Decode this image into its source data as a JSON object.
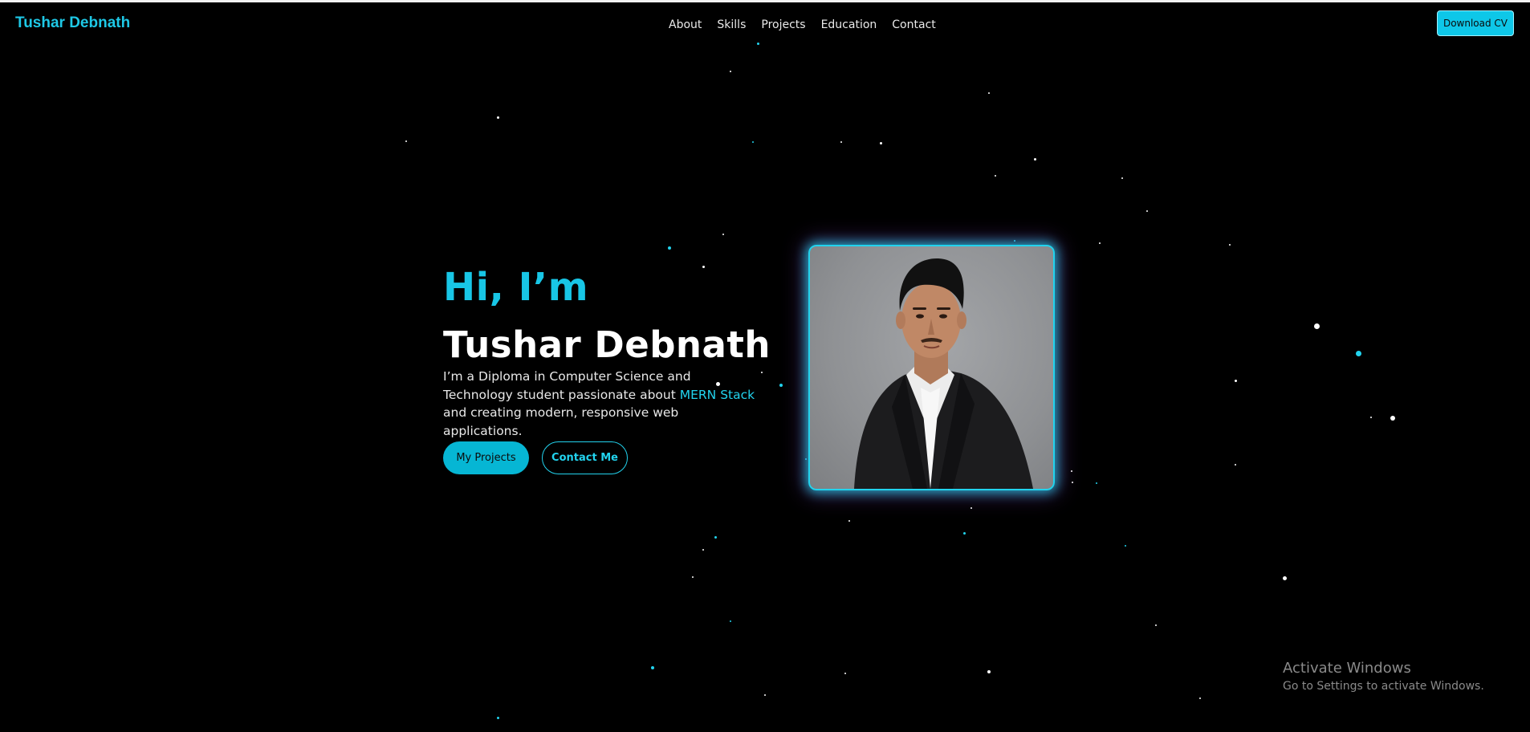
{
  "nav": {
    "brand": "Tushar Debnath",
    "links": [
      "About",
      "Skills",
      "Projects",
      "Education",
      "Contact"
    ],
    "cv_button": "Download CV"
  },
  "hero": {
    "greeting": "Hi, I’m",
    "name": "Tushar Debnath",
    "desc_prefix": "I’m a Diploma in Computer Science and Technology student passionate about ",
    "desc_highlight": "MERN Stack",
    "desc_suffix": " and creating modern, responsive web applications.",
    "primary_button": "My Projects",
    "secondary_button": "Contact Me"
  },
  "watermark": {
    "title": "Activate Windows",
    "subtitle": "Go to Settings to activate Windows."
  },
  "colors": {
    "accent": "#22d3ee",
    "background": "#000000",
    "portrait_glow": "#a855f7"
  }
}
